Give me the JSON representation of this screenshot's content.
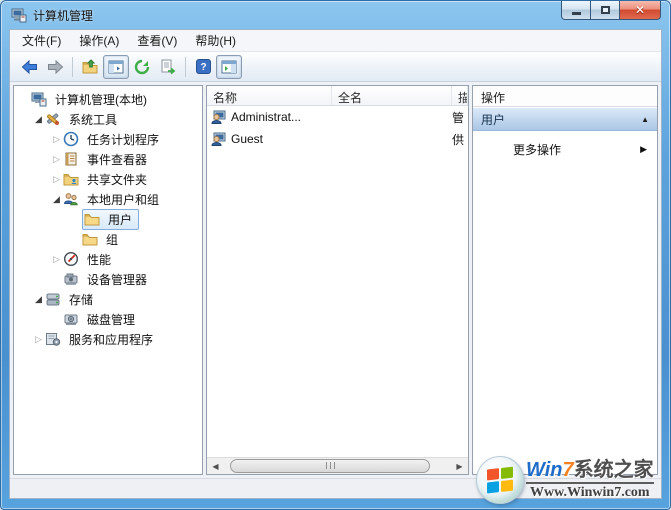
{
  "window": {
    "title": "计算机管理"
  },
  "menu": {
    "items": [
      "文件(F)",
      "操作(A)",
      "查看(V)",
      "帮助(H)"
    ]
  },
  "toolbar": {
    "buttons": [
      "back",
      "forward",
      "up-one-level",
      "show-console-tree",
      "refresh",
      "export-list",
      "help",
      "show-action-pane"
    ]
  },
  "tree": {
    "items": [
      {
        "label": "计算机管理(本地)",
        "depth": 0,
        "expand": "none",
        "icon": "computer-management",
        "selected": false
      },
      {
        "label": "系统工具",
        "depth": 1,
        "expand": "expanded",
        "icon": "system-tools",
        "selected": false
      },
      {
        "label": "任务计划程序",
        "depth": 2,
        "expand": "collapsed",
        "icon": "task-scheduler",
        "selected": false
      },
      {
        "label": "事件查看器",
        "depth": 2,
        "expand": "collapsed",
        "icon": "event-viewer",
        "selected": false
      },
      {
        "label": "共享文件夹",
        "depth": 2,
        "expand": "collapsed",
        "icon": "shared-folders",
        "selected": false
      },
      {
        "label": "本地用户和组",
        "depth": 2,
        "expand": "expanded",
        "icon": "local-users-groups",
        "selected": false
      },
      {
        "label": "用户",
        "depth": 3,
        "expand": "none",
        "icon": "folder",
        "selected": true
      },
      {
        "label": "组",
        "depth": 3,
        "expand": "none",
        "icon": "folder",
        "selected": false
      },
      {
        "label": "性能",
        "depth": 2,
        "expand": "collapsed",
        "icon": "performance",
        "selected": false
      },
      {
        "label": "设备管理器",
        "depth": 2,
        "expand": "none",
        "icon": "device-manager",
        "selected": false
      },
      {
        "label": "存储",
        "depth": 1,
        "expand": "expanded",
        "icon": "storage",
        "selected": false
      },
      {
        "label": "磁盘管理",
        "depth": 2,
        "expand": "none",
        "icon": "disk-management",
        "selected": false
      },
      {
        "label": "服务和应用程序",
        "depth": 1,
        "expand": "collapsed",
        "icon": "services-applications",
        "selected": false
      }
    ]
  },
  "list": {
    "columns": [
      "名称",
      "全名",
      "描"
    ],
    "rows": [
      {
        "name": "Administrat...",
        "full_name": "",
        "description": "管"
      },
      {
        "name": "Guest",
        "full_name": "",
        "description": "供"
      }
    ]
  },
  "actions": {
    "header": "操作",
    "section_title": "用户",
    "more_actions": "更多操作"
  },
  "watermark": {
    "brand_en": "Win",
    "brand_num": "7",
    "brand_cn": "系统之家",
    "url": "Www.Winwin7.com"
  },
  "colors": {
    "frame_blue": "#4a90cf",
    "close_red": "#cf4a30",
    "selection_border": "#84acdd",
    "section_bar": "#aac7e6"
  }
}
